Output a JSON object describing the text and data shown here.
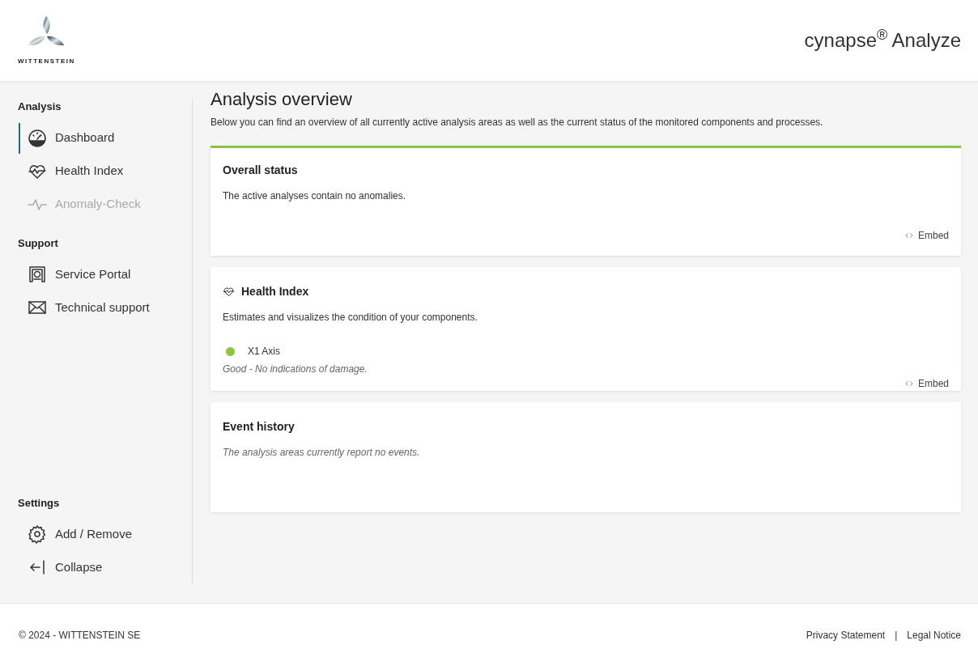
{
  "header": {
    "logo_text": "WITTENSTEIN",
    "app_title": "cynapse$^{®}$ Analyze"
  },
  "sidebar": {
    "sections": [
      {
        "title": "Analysis",
        "items": [
          {
            "label": "Dashboard",
            "kind": "dashboard",
            "selected": true,
            "disabled": false
          },
          {
            "label": "Health Index",
            "kind": "health",
            "selected": false,
            "disabled": false
          },
          {
            "label": "Anomaly-Check",
            "kind": "pulse",
            "selected": false,
            "disabled": true
          }
        ]
      },
      {
        "title": "Support",
        "items": [
          {
            "label": "Service Portal",
            "kind": "portal",
            "selected": false,
            "disabled": false
          },
          {
            "label": "Technical support",
            "kind": "mail",
            "selected": false,
            "disabled": false
          }
        ]
      },
      {
        "title": "Settings",
        "items": [
          {
            "label": "Add / Remove",
            "kind": "gear",
            "selected": false,
            "disabled": false
          },
          {
            "label": "Collapse",
            "kind": "collapse",
            "selected": false,
            "disabled": false
          }
        ]
      }
    ]
  },
  "page": {
    "title": "Analysis overview",
    "subtitle": "Below you can find an overview of all currently active analysis areas as well as the current status of the monitored components and processes."
  },
  "cards": [
    {
      "kind": "overall",
      "title": "Overall status",
      "color": "#8bc34a",
      "text": "The active analyses contain no anomalies.",
      "embed": "Embed"
    },
    {
      "kind": "health",
      "title": "Health Index",
      "text": "Estimates and visualizes the condition of your components.",
      "components": [
        {
          "name": "X1 Axis",
          "color": "#8cc63f",
          "note": "Good - No indications of damage."
        }
      ],
      "embed": "Embed"
    },
    {
      "kind": "events",
      "title": "Event history",
      "note": "The analysis areas currently report no events."
    }
  ],
  "footer": {
    "copyright": "© 2024 - WITTENSTEIN SE",
    "links": [
      "Privacy Statement",
      "Legal Notice"
    ],
    "separator": "|"
  }
}
